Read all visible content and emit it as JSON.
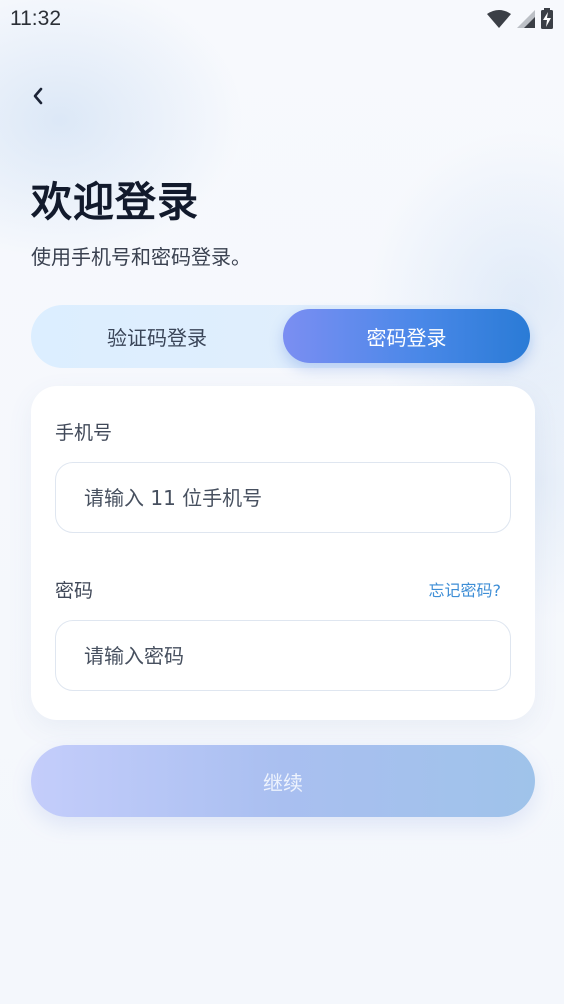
{
  "status_bar": {
    "time": "11:32"
  },
  "header": {
    "title": "欢迎登录",
    "subtitle": "使用手机号和密码登录。"
  },
  "tabs": [
    {
      "label": "验证码登录",
      "selected": false
    },
    {
      "label": "密码登录",
      "selected": true
    }
  ],
  "form": {
    "phone_label": "手机号",
    "phone_placeholder": "请输入 11 位手机号",
    "password_label": "密码",
    "forgot_label": "忘记密码?",
    "password_placeholder": "请输入密码"
  },
  "continue_label": "继续",
  "icons": {
    "back": "chevron-left-icon",
    "wifi": "wifi-icon",
    "signal": "signal-icon",
    "battery": "battery-charging-icon"
  },
  "colors": {
    "accent_start": "#7b8ef2",
    "accent_end": "#2a7bd6",
    "link": "#3e8ed6",
    "title": "#121a2c"
  }
}
